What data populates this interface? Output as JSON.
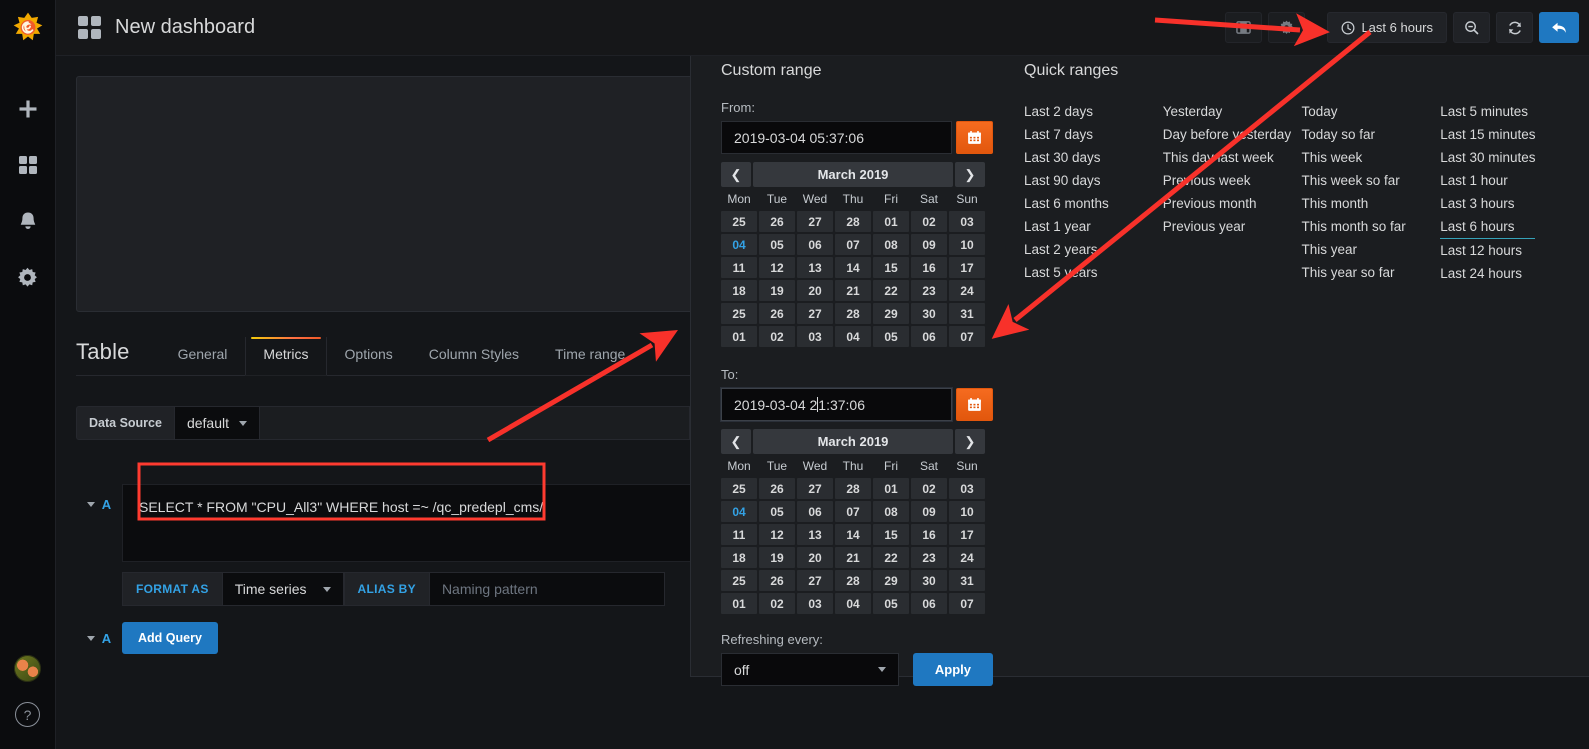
{
  "app": {
    "logo_icon": "grafana-logo-icon",
    "dashboard_title": "New dashboard",
    "grid_icon": "grid-icon"
  },
  "sidebar": {
    "items": [
      {
        "icon": "plus-icon",
        "name": "create"
      },
      {
        "icon": "grid-icon",
        "name": "dashboards"
      },
      {
        "icon": "bell-icon",
        "name": "alerting"
      },
      {
        "icon": "gear-icon",
        "name": "configuration"
      }
    ],
    "avatar": "user-avatar",
    "help_label": "?"
  },
  "toolbar": {
    "save_icon": "save-dashboard-icon",
    "settings_icon": "dashboard-settings-icon",
    "time_range_label": "Last 6 hours",
    "clock_icon": "clock-icon",
    "zoom_out_icon": "zoom-out-icon",
    "refresh_icon": "refresh-icon",
    "back_icon": "back-arrow-icon"
  },
  "editor": {
    "panel_type": "Table",
    "tabs": [
      {
        "label": "General",
        "active": false
      },
      {
        "label": "Metrics",
        "active": true
      },
      {
        "label": "Options",
        "active": false
      },
      {
        "label": "Column Styles",
        "active": false
      },
      {
        "label": "Time range",
        "active": false
      }
    ],
    "data_source_label": "Data Source",
    "data_source_value": "default",
    "query": {
      "letter": "A",
      "text": "SELECT * FROM \"CPU_All3\" WHERE host =~ /qc_predepl_cms/",
      "format_as_label": "FORMAT AS",
      "format_as_value": "Time series",
      "alias_by_label": "ALIAS BY",
      "alias_placeholder": "Naming pattern"
    },
    "add_query": {
      "letter": "A",
      "label": "Add Query"
    }
  },
  "timepicker": {
    "custom_range_title": "Custom range",
    "from_label": "From:",
    "from_value": "2019-03-04 05:37:06",
    "to_label": "To:",
    "to_value_before_caret": "2019-03-04 2",
    "to_value_after_caret": "1:37:06",
    "calendar_icon": "calendar-icon",
    "prev_icon": "chevron-left-icon",
    "next_icon": "chevron-right-icon",
    "month_title": "March 2019",
    "weekdays": [
      "Mon",
      "Tue",
      "Wed",
      "Thu",
      "Fri",
      "Sat",
      "Sun"
    ],
    "days": [
      "25",
      "26",
      "27",
      "28",
      "01",
      "02",
      "03",
      "04",
      "05",
      "06",
      "07",
      "08",
      "09",
      "10",
      "11",
      "12",
      "13",
      "14",
      "15",
      "16",
      "17",
      "18",
      "19",
      "20",
      "21",
      "22",
      "23",
      "24",
      "25",
      "26",
      "27",
      "28",
      "29",
      "30",
      "31",
      "01",
      "02",
      "03",
      "04",
      "05",
      "06",
      "07"
    ],
    "selected_day_index": 7,
    "refresh_label": "Refreshing every:",
    "refresh_value": "off",
    "apply_label": "Apply",
    "quick_ranges_title": "Quick ranges",
    "quick_ranges_columns": [
      [
        "Last 2 days",
        "Last 7 days",
        "Last 30 days",
        "Last 90 days",
        "Last 6 months",
        "Last 1 year",
        "Last 2 years",
        "Last 5 years"
      ],
      [
        "Yesterday",
        "Day before yesterday",
        "This day last week",
        "Previous week",
        "Previous month",
        "Previous year"
      ],
      [
        "Today",
        "Today so far",
        "This week",
        "This week so far",
        "This month",
        "This month so far",
        "This year",
        "This year so far"
      ],
      [
        "Last 5 minutes",
        "Last 15 minutes",
        "Last 30 minutes",
        "Last 1 hour",
        "Last 3 hours",
        "Last 6 hours",
        "Last 12 hours",
        "Last 24 hours"
      ]
    ],
    "active_quick_range": "Last 6 hours"
  },
  "annotations": {
    "arrow_color": "#f8312a",
    "highlight_color": "#ff3b30",
    "arrow_count": 3
  },
  "colors": {
    "accent_blue": "#1f78c1",
    "accent_orange": "#e2570d",
    "accent_teal": "#35a2b8",
    "link_blue": "#33a2e5",
    "bg_dark": "#141619",
    "panel_bg": "#1f2125"
  }
}
